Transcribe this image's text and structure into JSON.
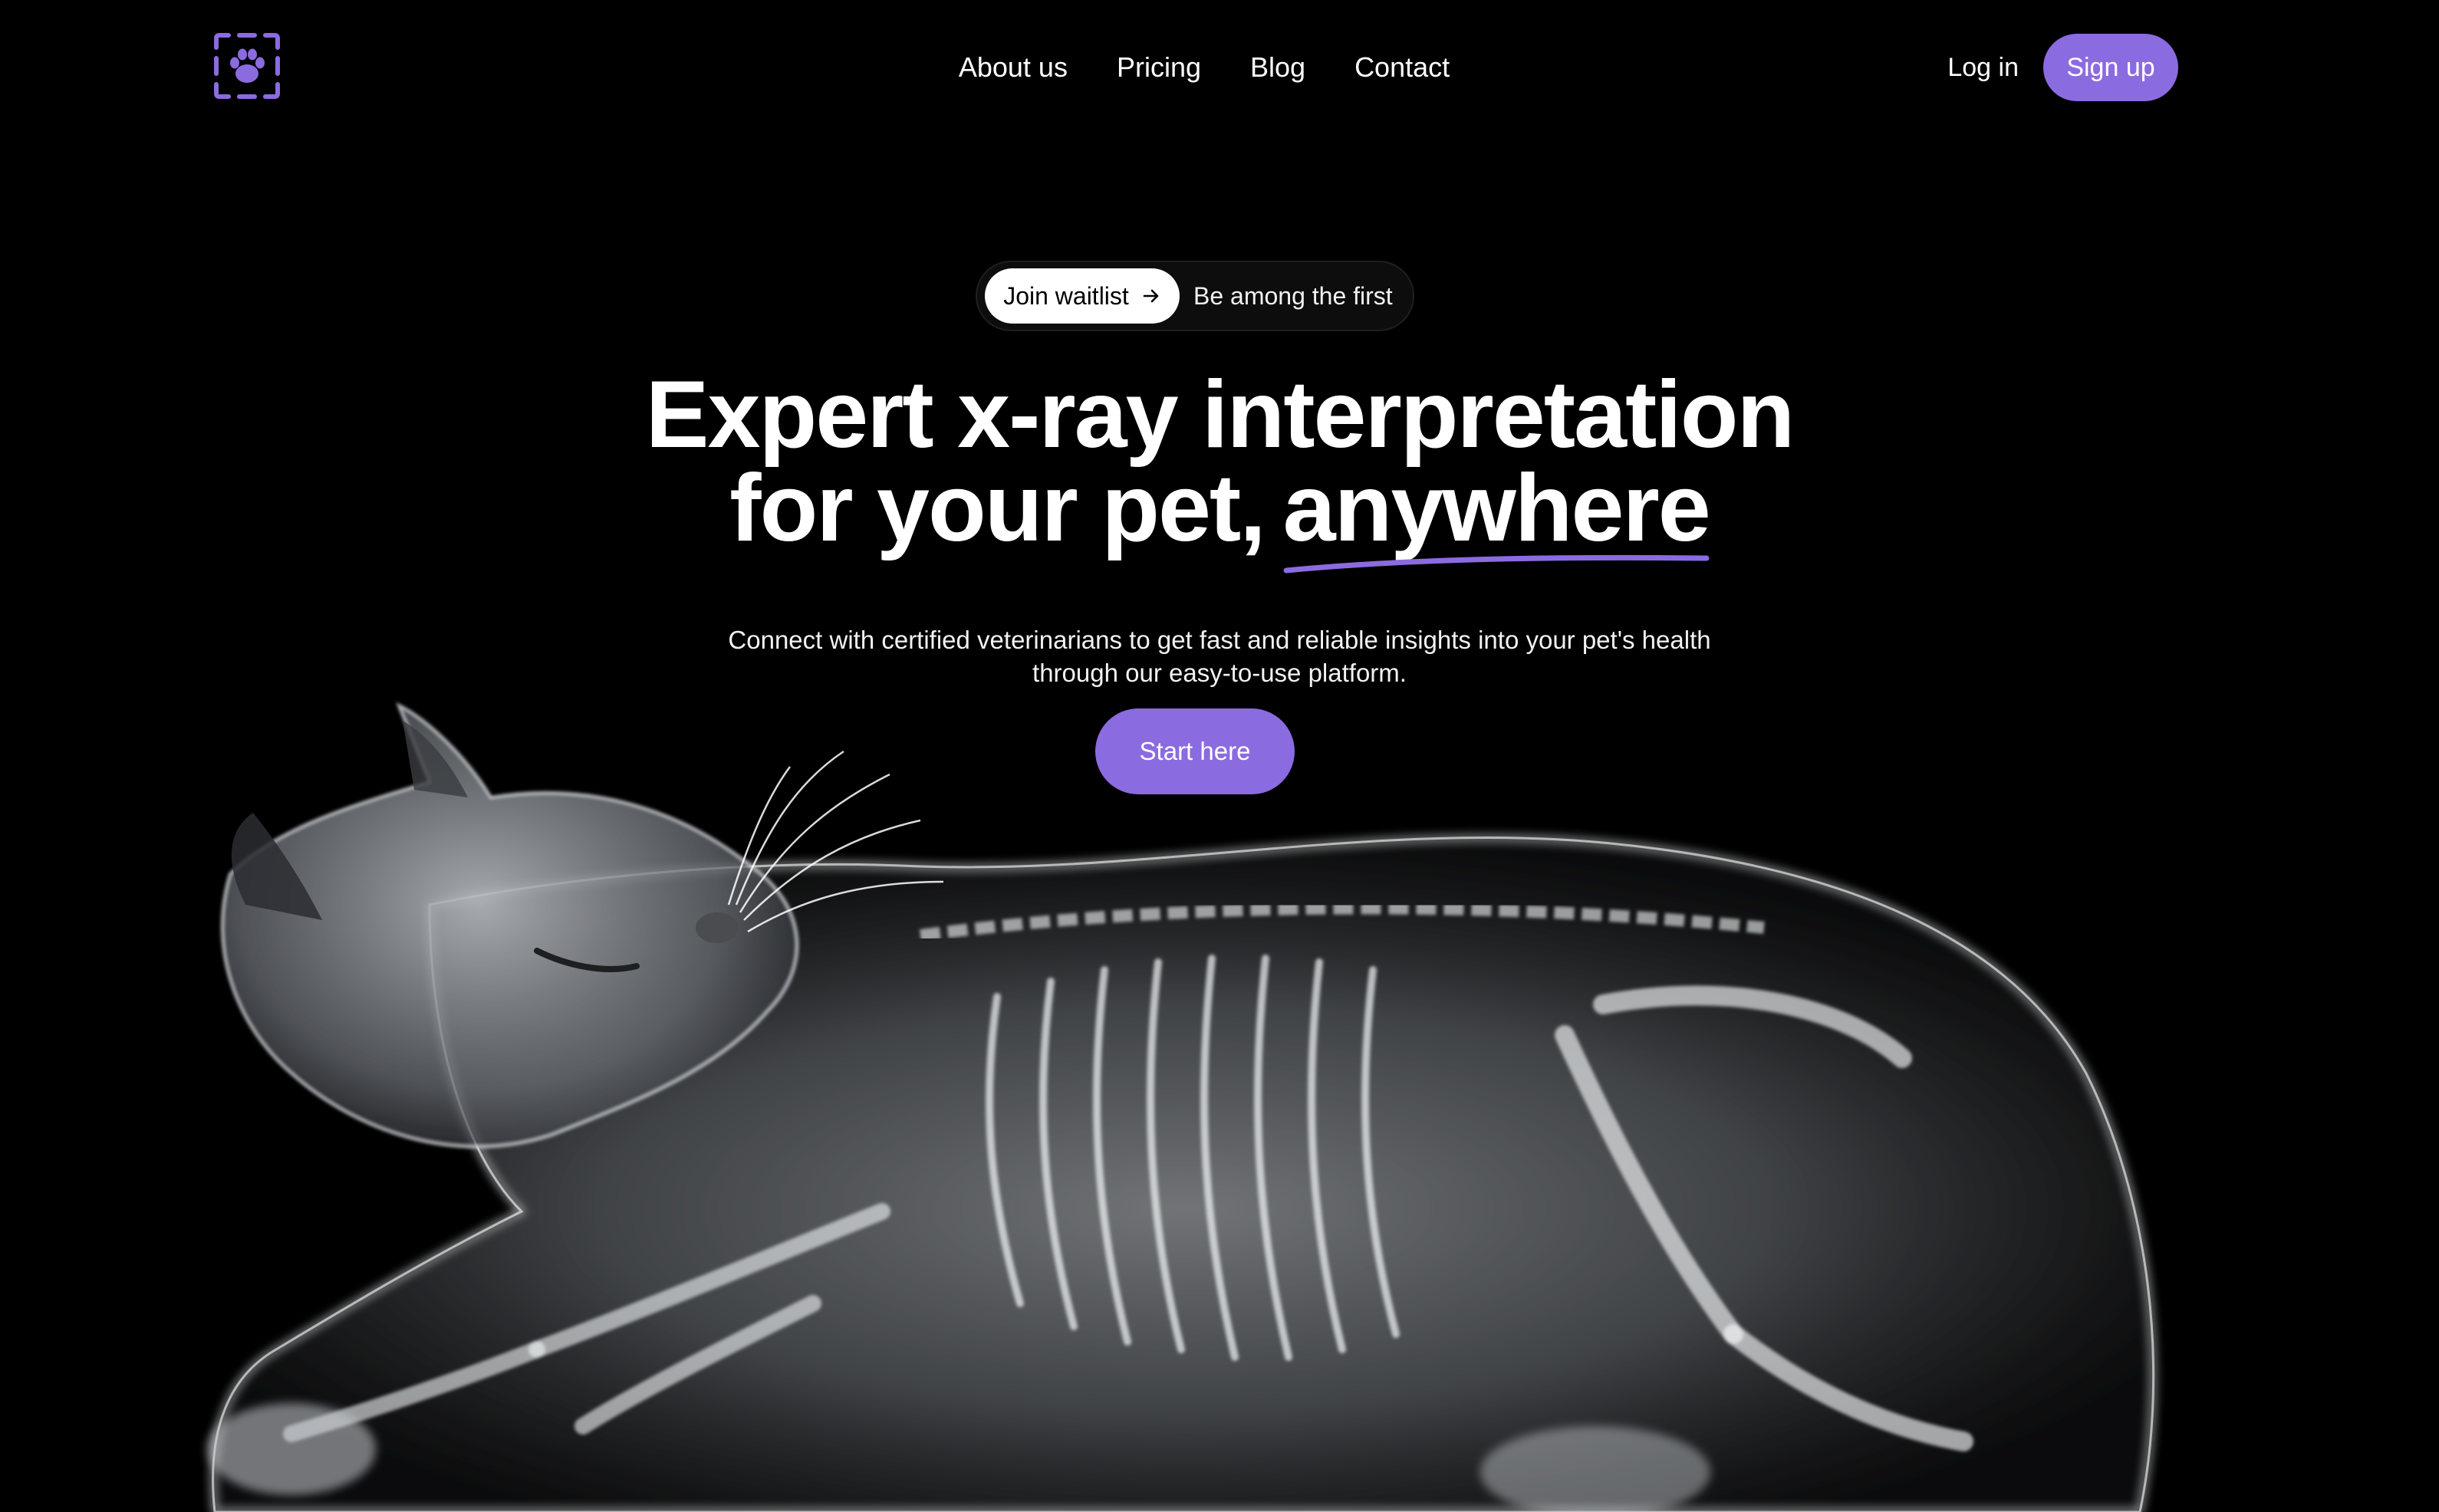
{
  "brand": {
    "logo_icon": "paw-scan-icon",
    "accent_color": "#8b6be0"
  },
  "nav": {
    "items": [
      {
        "label": "About us"
      },
      {
        "label": "Pricing"
      },
      {
        "label": "Blog"
      },
      {
        "label": "Contact"
      }
    ]
  },
  "auth": {
    "login_label": "Log in",
    "signup_label": "Sign up"
  },
  "waitlist": {
    "button_label": "Join waitlist",
    "button_icon": "arrow-right-icon",
    "text": "Be among the first"
  },
  "hero": {
    "headline_line1": "Expert x-ray interpretation",
    "headline_line2_prefix": "for your pet,",
    "headline_highlight": "anywhere",
    "subtitle_line1": "Connect with certified veterinarians to get fast and reliable insights into your pet's health",
    "subtitle_line2": "through our easy-to-use platform.",
    "cta_label": "Start here"
  },
  "illustration": {
    "subject": "x-ray-cat-image"
  }
}
